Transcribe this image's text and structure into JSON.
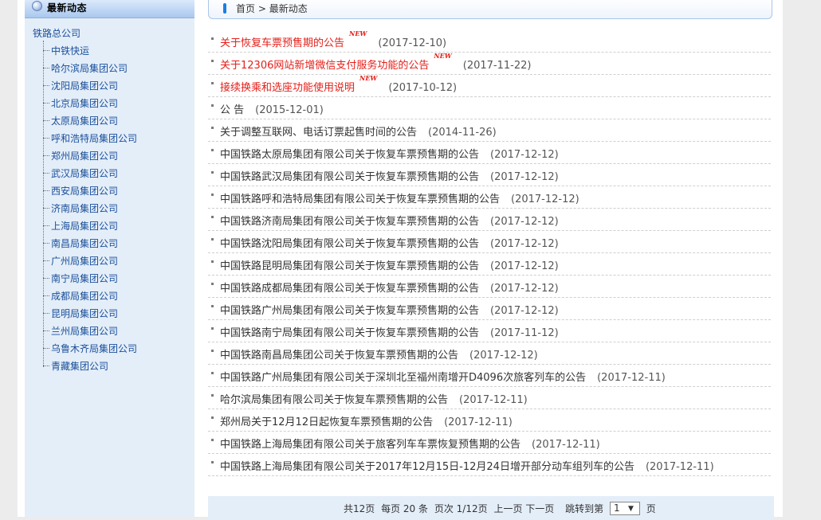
{
  "sidebar": {
    "header_title": "最新动态",
    "root": "铁路总公司",
    "items": [
      "中铁快运",
      "哈尔滨局集团公司",
      "沈阳局集团公司",
      "北京局集团公司",
      "太原局集团公司",
      "呼和浩特局集团公司",
      "郑州局集团公司",
      "武汉局集团公司",
      "西安局集团公司",
      "济南局集团公司",
      "上海局集团公司",
      "南昌局集团公司",
      "广州局集团公司",
      "南宁局集团公司",
      "成都局集团公司",
      "昆明局集团公司",
      "兰州局集团公司",
      "乌鲁木齐局集团公司",
      "青藏集团公司"
    ]
  },
  "breadcrumb": {
    "home": "首页",
    "separator": ">",
    "current": "最新动态"
  },
  "news": [
    {
      "title": "关于恢复车票预售期的公告",
      "date": "(2017-12-10)",
      "hot": true,
      "new_badge": "NEW"
    },
    {
      "title": "关于12306网站新增微信支付服务功能的公告",
      "date": "(2017-11-22)",
      "hot": true,
      "new_badge": "NEW"
    },
    {
      "title": "接续换乘和选座功能使用说明",
      "date": "(2017-10-12)",
      "hot": true,
      "new_badge": "NEW"
    },
    {
      "title": "公 告",
      "date": "(2015-12-01)",
      "hot": false
    },
    {
      "title": "关于调整互联网、电话订票起售时间的公告",
      "date": "(2014-11-26)",
      "hot": false
    },
    {
      "title": "中国铁路太原局集团有限公司关于恢复车票预售期的公告",
      "date": "(2017-12-12)",
      "hot": false
    },
    {
      "title": "中国铁路武汉局集团有限公司关于恢复车票预售期的公告",
      "date": "(2017-12-12)",
      "hot": false
    },
    {
      "title": "中国铁路呼和浩特局集团有限公司关于恢复车票预售期的公告",
      "date": "(2017-12-12)",
      "hot": false
    },
    {
      "title": "中国铁路济南局集团有限公司关于恢复车票预售期的公告",
      "date": "(2017-12-12)",
      "hot": false
    },
    {
      "title": "中国铁路沈阳局集团有限公司关于恢复车票预售期的公告",
      "date": "(2017-12-12)",
      "hot": false
    },
    {
      "title": "中国铁路昆明局集团有限公司关于恢复车票预售期的公告",
      "date": "(2017-12-12)",
      "hot": false
    },
    {
      "title": "中国铁路成都局集团有限公司关于恢复车票预售期的公告",
      "date": "(2017-12-12)",
      "hot": false
    },
    {
      "title": "中国铁路广州局集团有限公司关于恢复车票预售期的公告",
      "date": "(2017-12-12)",
      "hot": false
    },
    {
      "title": "中国铁路南宁局集团有限公司关于恢复车票预售期的公告",
      "date": "(2017-11-12)",
      "hot": false
    },
    {
      "title": "中国铁路南昌局集团公司关于恢复车票预售期的公告",
      "date": "(2017-12-12)",
      "hot": false
    },
    {
      "title": "中国铁路广州局集团有限公司关于深圳北至福州南增开D4096次旅客列车的公告",
      "date": "(2017-12-11)",
      "hot": false
    },
    {
      "title": "哈尔滨局集团有限公司关于恢复车票预售期的公告",
      "date": "(2017-12-11)",
      "hot": false
    },
    {
      "title": "郑州局关于12月12日起恢复车票预售期的公告",
      "date": "(2017-12-11)",
      "hot": false
    },
    {
      "title": "中国铁路上海局集团有限公司关于旅客列车车票恢复预售期的公告",
      "date": "(2017-12-11)",
      "hot": false
    },
    {
      "title": "中国铁路上海局集团有限公司关于2017年12月15日-12月24日增开部分动车组列车的公告",
      "date": "(2017-12-11)",
      "hot": false
    }
  ],
  "pager": {
    "total": "共12页",
    "per_page": "每页 20 条",
    "page_of": "页次 1/12页",
    "prev": "上一页",
    "next": "下一页",
    "jump": "跳转到第",
    "selected": "1",
    "unit": "页"
  },
  "colors": {
    "hot": "#e4201a",
    "link": "#1a4f9a",
    "sidebar_bg": "#e4eef9"
  }
}
